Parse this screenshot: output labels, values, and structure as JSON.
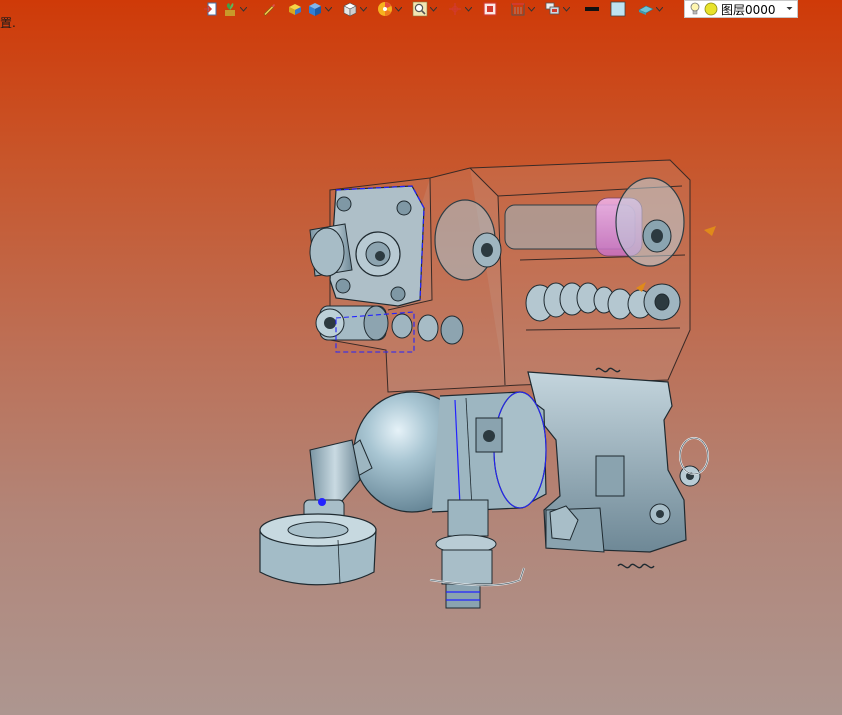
{
  "status": {
    "text": "置."
  },
  "toolbar": {
    "items": [
      {
        "icon": "exit-icon"
      },
      {
        "icon": "plant-icon"
      },
      {
        "icon": "pen-icon"
      },
      {
        "icon": "box-yellow-icon"
      },
      {
        "icon": "cube-blue-icon"
      },
      {
        "icon": "cube-white-icon"
      },
      {
        "icon": "color-wheel-icon"
      },
      {
        "icon": "zoom-icon"
      },
      {
        "icon": "crosshair-icon"
      },
      {
        "icon": "frame-red-icon"
      },
      {
        "icon": "section-icon"
      },
      {
        "icon": "layers-icon"
      },
      {
        "icon": "line-black-icon"
      },
      {
        "icon": "square-lightblue-icon"
      },
      {
        "icon": "surface-icon"
      }
    ],
    "colors": {
      "accent": "#2f7fd6",
      "selection": "#1a1aff"
    }
  },
  "layer": {
    "name": "图层0000",
    "icons": [
      "bulb-icon",
      "sun-icon"
    ]
  },
  "viewport": {
    "background_top": "#cf3a08",
    "background_bottom": "#ad9690",
    "model_color": "#9fb5c0",
    "highlight_color": "#d98ad6"
  }
}
